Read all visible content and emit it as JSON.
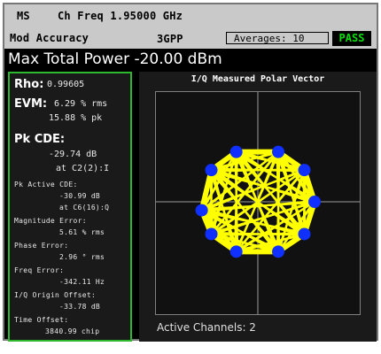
{
  "header": {
    "mode": "MS",
    "ch_freq": "Ch Freq 1.95000 GHz",
    "measurement": "Mod Accuracy",
    "standard": "3GPP",
    "averages": "Averages:  10",
    "status": "PASS"
  },
  "title_bar": "Max Total Power -20.00 dBm",
  "results": {
    "rho_label": "Rho:",
    "rho_value": "0.99605",
    "evm_label": "EVM:",
    "evm_rms": "6.29 % rms",
    "evm_pk": "15.88 % pk",
    "pk_cde_label": "Pk CDE:",
    "pk_cde_value": "-29.74 dB",
    "pk_cde_at": "at C2(2):I",
    "pk_active_cde_label": "Pk Active CDE:",
    "pk_active_cde_value": "-30.99 dB",
    "pk_active_cde_at": "at C6(16):Q",
    "mag_error_label": "Magnitude Error:",
    "mag_error_value": "5.61 % rms",
    "phase_error_label": "Phase Error:",
    "phase_error_value": "2.96 ° rms",
    "freq_error_label": "Freq Error:",
    "freq_error_value": "-342.11 Hz",
    "iq_origin_label": "I/Q Origin Offset:",
    "iq_origin_value": "-33.78 dB",
    "time_offset_label": "Time Offset:",
    "time_offset_value": "3840.99 chip"
  },
  "plot": {
    "title": "I/Q Measured Polar Vector",
    "active_channels": "Active Channels: 2",
    "trace_color": "#ffff00",
    "symbol_color": "#1030ff",
    "grid_color": "#9a9a9a",
    "symbol_points": [
      [
        0.36,
        0.88
      ],
      [
        0.82,
        0.56
      ],
      [
        1.0,
        0.0
      ],
      [
        0.82,
        -0.57
      ],
      [
        0.36,
        -0.88
      ],
      [
        -0.38,
        -0.88
      ],
      [
        -0.82,
        -0.57
      ],
      [
        -0.99,
        -0.15
      ],
      [
        -0.82,
        0.56
      ],
      [
        -0.38,
        0.88
      ]
    ]
  },
  "colors": {
    "header_bg": "#c9c9c9",
    "screen_bg": "#000000",
    "panel_border": "#2db82d",
    "pass": "#00e000"
  }
}
